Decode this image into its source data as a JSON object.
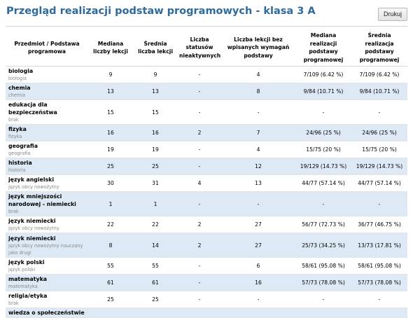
{
  "title": "Przegląd realizacji podstaw programowych - klasa 3 A",
  "print_label": "Drukuj",
  "columns": [
    "Przedmiot / Podstawa programowa",
    "Mediana liczby lekcji",
    "Średnia liczba lekcji",
    "Liczba statusów nieaktywnych",
    "Liczba lekcji bez wpisanych wymagań podstawy",
    "Mediana realizacji podstawy programowej",
    "Średnia realizacja podstawy programowej"
  ],
  "rows": [
    {
      "subject": "biologia",
      "category": "biologia",
      "median": "9",
      "avg": "9",
      "inactive": "-",
      "no_req": "4",
      "median_real": "7/109 (6.42 %)",
      "avg_real": "7/109 (6.42 %)"
    },
    {
      "subject": "chemia",
      "category": "chemia",
      "median": "13",
      "avg": "13",
      "inactive": "-",
      "no_req": "8",
      "median_real": "9/84 (10.71 %)",
      "avg_real": "9/84 (10.71 %)"
    },
    {
      "subject": "edukacja dla bezpieczeństwa",
      "category": "brak",
      "median": "15",
      "avg": "15",
      "inactive": "-",
      "no_req": "-",
      "median_real": "-",
      "avg_real": "-"
    },
    {
      "subject": "fizyka",
      "category": "fizyka",
      "median": "16",
      "avg": "16",
      "inactive": "2",
      "no_req": "7",
      "median_real": "24/96 (25 %)",
      "avg_real": "24/96 (25 %)"
    },
    {
      "subject": "geografia",
      "category": "geografia",
      "median": "19",
      "avg": "19",
      "inactive": "-",
      "no_req": "4",
      "median_real": "15/75 (20 %)",
      "avg_real": "15/75 (20 %)"
    },
    {
      "subject": "historia",
      "category": "historia",
      "median": "25",
      "avg": "25",
      "inactive": "-",
      "no_req": "12",
      "median_real": "19/129 (14.73 %)",
      "avg_real": "19/129 (14.73 %)"
    },
    {
      "subject": "język angielski",
      "category": "język obcy nowożytny",
      "median": "30",
      "avg": "31",
      "inactive": "4",
      "no_req": "13",
      "median_real": "44/77 (57.14 %)",
      "avg_real": "44/77 (57.14 %)"
    },
    {
      "subject": "język mniejszości narodowej - niemiecki",
      "category": "brak",
      "median": "1",
      "avg": "1",
      "inactive": "-",
      "no_req": "-",
      "median_real": "-",
      "avg_real": "-"
    },
    {
      "subject": "język niemiecki",
      "category": "język obcy nowożytny",
      "median": "22",
      "avg": "22",
      "inactive": "2",
      "no_req": "27",
      "median_real": "56/77 (72.73 %)",
      "avg_real": "36/77 (46.75 %)"
    },
    {
      "subject": "język niemiecki",
      "category": "język obcy nowożytny nauczany jako drugi",
      "median": "8",
      "avg": "14",
      "inactive": "2",
      "no_req": "27",
      "median_real": "25/73 (34.25 %)",
      "avg_real": "13/73 (17.81 %)"
    },
    {
      "subject": "język polski",
      "category": "język polski",
      "median": "55",
      "avg": "55",
      "inactive": "-",
      "no_req": "6",
      "median_real": "58/61 (95.08 %)",
      "avg_real": "58/61 (95.08 %)"
    },
    {
      "subject": "matematyka",
      "category": "matematyka",
      "median": "61",
      "avg": "61",
      "inactive": "-",
      "no_req": "16",
      "median_real": "57/73 (78.08 %)",
      "avg_real": "57/73 (78.08 %)"
    },
    {
      "subject": "religia/etyka",
      "category": "brak",
      "median": "25",
      "avg": "25",
      "inactive": "-",
      "no_req": "-",
      "median_real": "-",
      "avg_real": "-"
    },
    {
      "subject": "wiedza o społeczeństwie",
      "category": "",
      "median": "",
      "avg": "",
      "inactive": "",
      "no_req": "",
      "median_real": "",
      "avg_real": ""
    }
  ]
}
